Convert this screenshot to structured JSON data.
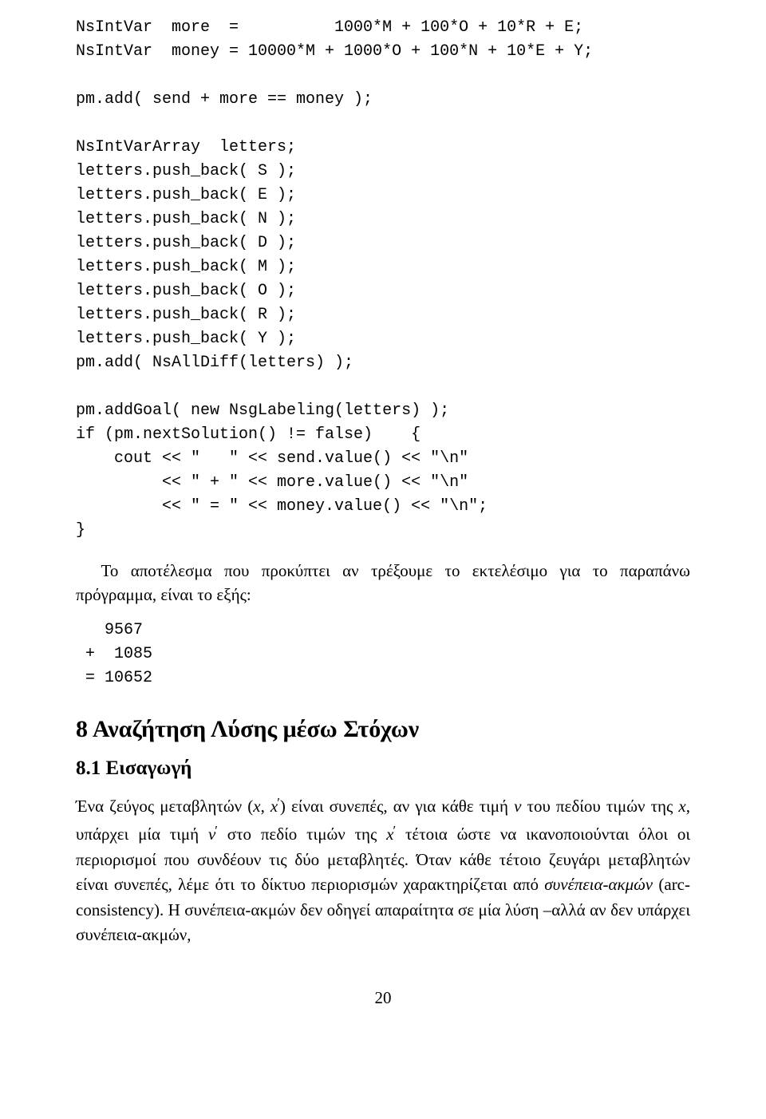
{
  "code1": "NsIntVar  more  =          1000*M + 100*O + 10*R + E;\nNsIntVar  money = 10000*M + 1000*O + 100*N + 10*E + Y;\n\npm.add( send + more == money );\n\nNsIntVarArray  letters;\nletters.push_back( S );\nletters.push_back( E );\nletters.push_back( N );\nletters.push_back( D );\nletters.push_back( M );\nletters.push_back( O );\nletters.push_back( R );\nletters.push_back( Y );\npm.add( NsAllDiff(letters) );\n\npm.addGoal( new NsgLabeling(letters) );\nif (pm.nextSolution() != false)    {\n    cout << \"   \" << send.value() << \"\\n\"\n         << \" + \" << more.value() << \"\\n\"\n         << \" = \" << money.value() << \"\\n\";\n}",
  "para1": "Το αποτέλεσμα που προκύπτει αν τρέξουμε το εκτελέσιμο για το παραπάνω πρόγραμμα, είναι το εξής:",
  "output": "   9567\n +  1085\n = 10652",
  "section": "8   Αναζήτηση Λύσης μέσω Στόχων",
  "subsection": "8.1   Εισαγωγή",
  "intro_pre": "Ένα ζεύγος μεταβλητών (",
  "x": "x",
  "comma": ",",
  "sp": " ",
  "xprime": "x",
  "prime": "′",
  "intro_mid1": ") είναι συνεπές, αν για κάθε τιμή ",
  "v": "v",
  "intro_mid2": " του πεδίου τιμών της ",
  "x2": "x",
  "intro_mid3": ", υπάρχει μία τιμή ",
  "vprime": "v",
  "intro_mid4": " στο πεδίο τιμών της ",
  "x3": "x",
  "intro_tail": " τέτοια ώστε να ικανοποιούνται όλοι οι περιορισμοί που συνδέουν τις δύο μεταβλητές. Όταν κάθε τέτοιο ζευγάρι μεταβλητών είναι συνεπές, λέμε ότι το δίκτυο περιορισμών χαρακτηρίζεται από ",
  "em1": "συνέπεια-ακμών",
  "em_paren": " (arc-consistency).  Η συνέπεια-ακμών δεν οδηγεί απαραίτητα σε μία λύση –αλλά αν δεν υπάρχει συνέπεια-ακμών,",
  "pagenum": "20"
}
